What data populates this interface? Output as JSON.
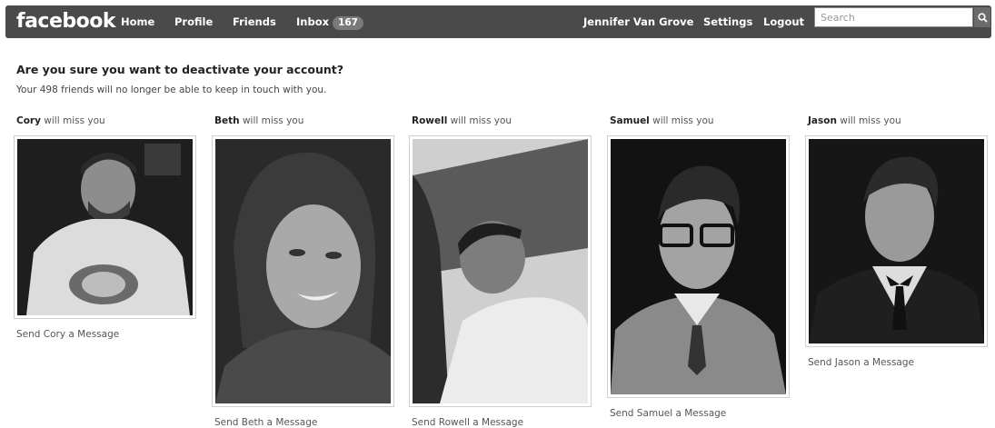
{
  "topbar": {
    "logo": "facebook",
    "nav": [
      {
        "label": "Home"
      },
      {
        "label": "Profile"
      },
      {
        "label": "Friends"
      },
      {
        "label": "Inbox",
        "badge": "167"
      }
    ],
    "user_name": "Jennifer Van Grove",
    "settings_label": "Settings",
    "logout_label": "Logout",
    "search_placeholder": "Search"
  },
  "main": {
    "heading": "Are you sure you want to deactivate your account?",
    "subtext": "Your 498 friends will no longer be able to keep in touch with you."
  },
  "friends": [
    {
      "name": "Cory",
      "miss_suffix": " will miss you",
      "send_label": "Send Cory a Message"
    },
    {
      "name": "Beth",
      "miss_suffix": " will miss you",
      "send_label": "Send Beth a Message"
    },
    {
      "name": "Rowell",
      "miss_suffix": " will miss you",
      "send_label": "Send Rowell a Message"
    },
    {
      "name": "Samuel",
      "miss_suffix": " will miss you",
      "send_label": "Send Samuel a Message"
    },
    {
      "name": "Jason",
      "miss_suffix": " will miss you",
      "send_label": "Send Jason a Message"
    }
  ],
  "colors": {
    "topbar": "#4a4a4a",
    "text": "#333333"
  }
}
